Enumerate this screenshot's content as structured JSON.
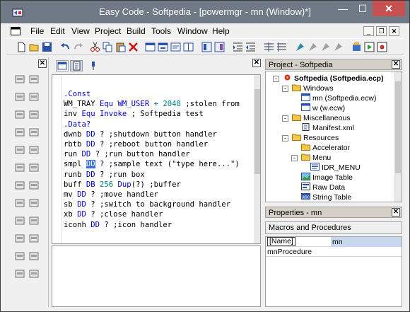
{
  "window": {
    "title": "Easy Code - Softpedia - [powermgr - mn (Window)*]"
  },
  "menu": {
    "items": [
      "File",
      "Edit",
      "View",
      "Project",
      "Build",
      "Tools",
      "Window",
      "Help"
    ]
  },
  "editor": {
    "lines": [
      [
        {
          "t": ".Const",
          "c": "dr"
        }
      ],
      [
        {
          "t": "WM_TRAY "
        },
        {
          "t": "Equ",
          "c": "kw"
        },
        {
          "t": " WM_USER ",
          "c": "kw"
        },
        {
          "t": "+ 2048",
          "c": "num"
        },
        {
          "t": " ;stolen from"
        }
      ],
      [
        {
          "t": "inv "
        },
        {
          "t": "Equ Invoke",
          "c": "kw"
        },
        {
          "t": " ; Softpedia test"
        }
      ],
      [
        {
          "t": ".Data?",
          "c": "dr"
        }
      ],
      [
        {
          "t": "dwnb "
        },
        {
          "t": "DD",
          "c": "kw"
        },
        {
          "t": " ? ;shutdown button handler"
        }
      ],
      [
        {
          "t": "rbtb "
        },
        {
          "t": "DD",
          "c": "kw"
        },
        {
          "t": " ? ;reboot button handler"
        }
      ],
      [
        {
          "t": "run "
        },
        {
          "t": "DD",
          "c": "kw"
        },
        {
          "t": " ? ;run button handler"
        }
      ],
      [
        {
          "t": "smpl "
        },
        {
          "t": "DD",
          "c": "hl"
        },
        {
          "t": " ? ;sample text (\"type here...\")"
        }
      ],
      [
        {
          "t": "runb "
        },
        {
          "t": "DD",
          "c": "kw"
        },
        {
          "t": " ? ;run box"
        }
      ],
      [
        {
          "t": "buff "
        },
        {
          "t": "DB",
          "c": "kw"
        },
        {
          "t": " 256",
          "c": "num"
        },
        {
          "t": " Dup",
          "c": "kw"
        },
        {
          "t": "(?) ;buffer"
        }
      ],
      [
        {
          "t": "mv "
        },
        {
          "t": "DD",
          "c": "kw"
        },
        {
          "t": " ? ;move handler"
        }
      ],
      [
        {
          "t": "sb "
        },
        {
          "t": "DD",
          "c": "kw"
        },
        {
          "t": " ? ;switch to background handler"
        }
      ],
      [
        {
          "t": "xb "
        },
        {
          "t": "DD",
          "c": "kw"
        },
        {
          "t": " ? ;close handler"
        }
      ],
      [
        {
          "t": "iconh "
        },
        {
          "t": "DD",
          "c": "kw"
        },
        {
          "t": " ? ;icon handler"
        }
      ]
    ]
  },
  "project_panel": {
    "title": "Project - Softpedia",
    "nodes": [
      {
        "label": "Softpedia (Softpedia.ecp)",
        "icon": "project-icon",
        "level": 0,
        "expander": "-",
        "bold": true
      },
      {
        "label": "Windows",
        "icon": "folder-icon",
        "level": 1,
        "expander": "-"
      },
      {
        "label": "mn (Softpedia.ecw)",
        "icon": "window-icon",
        "level": 2,
        "expander": ""
      },
      {
        "label": "w (w.ecw)",
        "icon": "window-icon",
        "level": 2,
        "expander": ""
      },
      {
        "label": "Miscellaneous",
        "icon": "folder-icon",
        "level": 1,
        "expander": "-"
      },
      {
        "label": "Manifest.xml",
        "icon": "xml-file-icon",
        "level": 2,
        "expander": ""
      },
      {
        "label": "Resources",
        "icon": "folder-icon",
        "level": 1,
        "expander": "-"
      },
      {
        "label": "Accelerator",
        "icon": "folder-icon",
        "level": 2,
        "expander": ""
      },
      {
        "label": "Menu",
        "icon": "folder-icon",
        "level": 2,
        "expander": "-"
      },
      {
        "label": "IDR_MENU",
        "icon": "menu-icon",
        "level": 3,
        "expander": ""
      },
      {
        "label": "Image Table",
        "icon": "image-table-icon",
        "level": 2,
        "expander": ""
      },
      {
        "label": "Raw Data",
        "icon": "raw-data-icon",
        "level": 2,
        "expander": ""
      },
      {
        "label": "String Table",
        "icon": "string-table-icon",
        "level": 2,
        "expander": ""
      }
    ]
  },
  "properties_panel": {
    "title": "Properties - mn",
    "selector": "Macros and Procedures",
    "rows": [
      {
        "key": "[Name]",
        "value": "mn"
      },
      {
        "key": "mnProcedure",
        "value": ""
      }
    ]
  },
  "colors": {
    "titlebar": "#6f7a86",
    "close": "#c75050",
    "keyword": "#0000cc",
    "selection": "#3a6fd8"
  }
}
